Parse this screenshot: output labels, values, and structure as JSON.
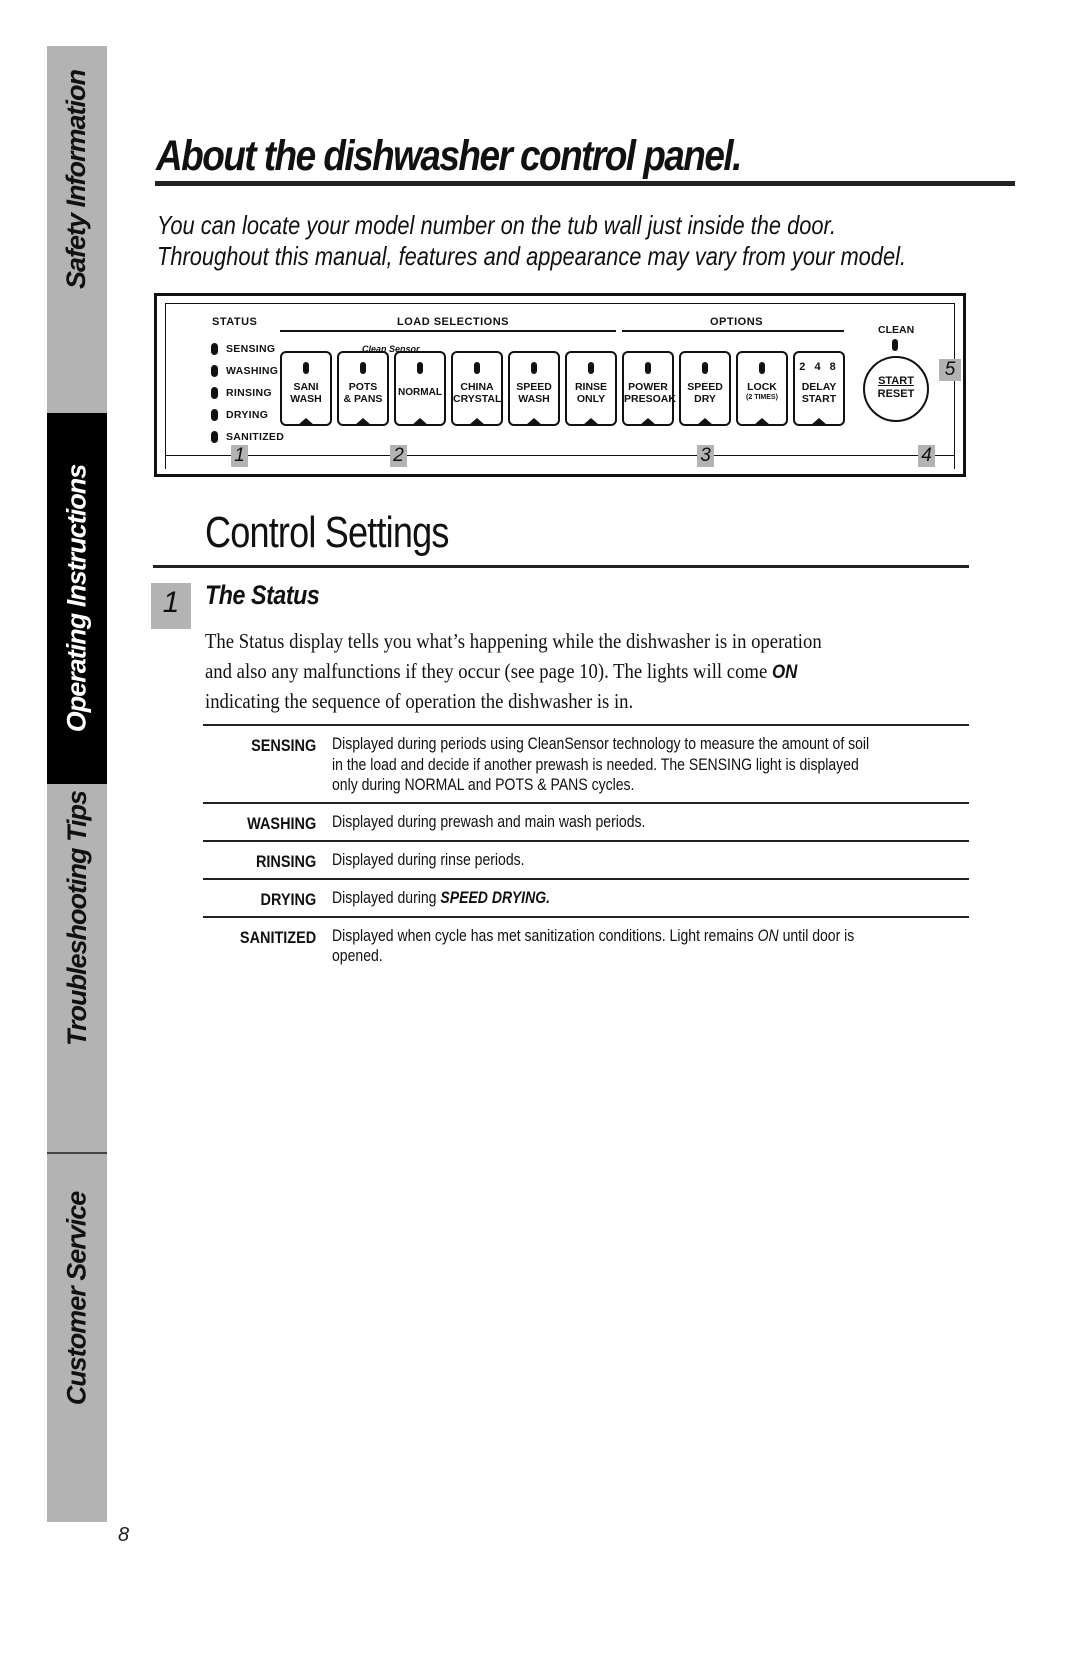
{
  "sidebar": {
    "tabs": [
      {
        "label": "Safety Information",
        "active": false
      },
      {
        "label": "Operating Instructions",
        "active": true
      },
      {
        "label": "Troubleshooting Tips",
        "active": false
      },
      {
        "label": "Customer Service",
        "active": false
      }
    ]
  },
  "page_number": "8",
  "header": {
    "title": "About the dishwasher control panel.",
    "intro_line1": "You can locate your model number on the tub wall just inside the door.",
    "intro_line2": "Throughout this manual, features and appearance may vary from your model."
  },
  "panel": {
    "status_title": "STATUS",
    "status_lights": [
      "SENSING",
      "WASHING",
      "RINSING",
      "DRYING",
      "SANITIZED"
    ],
    "load_selections_title": "LOAD SELECTIONS",
    "options_title": "OPTIONS",
    "clean_sensor_label": "Clean Sensor",
    "load_buttons": [
      {
        "line1": "SANI",
        "line2": "WASH"
      },
      {
        "line1": "POTS",
        "line2": "& PANS"
      },
      {
        "line1": "NORMAL",
        "line2": ""
      },
      {
        "line1": "CHINA",
        "line2": "CRYSTAL"
      },
      {
        "line1": "SPEED",
        "line2": "WASH"
      },
      {
        "line1": "RINSE",
        "line2": "ONLY"
      }
    ],
    "option_buttons": [
      {
        "line1": "POWER",
        "line2": "PRESOAK"
      },
      {
        "line1": "SPEED",
        "line2": "DRY"
      },
      {
        "line1": "LOCK",
        "line2": "(2 TIMES)"
      },
      {
        "line1": "DELAY",
        "line2": "START",
        "digits": "2 4 8"
      }
    ],
    "clean_label": "CLEAN",
    "start_button": {
      "line1": "START",
      "line2": "RESET"
    },
    "callouts": [
      "1",
      "2",
      "3",
      "4",
      "5"
    ]
  },
  "control_settings": {
    "heading": "Control Settings",
    "section_number": "1",
    "section_title": "The Status",
    "body_line1": "The Status display tells you what’s happening while the dishwasher is in operation",
    "body_line2_pre": "and also any malfunctions if they occur (see page 10). The lights will come ",
    "body_line2_bold": "ON",
    "body_line3": "indicating the sequence of operation the dishwasher is in.",
    "definitions": [
      {
        "term": "SENSING",
        "lines": [
          "Displayed during periods using CleanSensor technology to measure the amount of soil",
          "in the load and decide if another prewash is needed. The SENSING light is displayed",
          "only during NORMAL and POTS & PANS cycles."
        ]
      },
      {
        "term": "WASHING",
        "lines": [
          "Displayed during prewash and main wash periods."
        ]
      },
      {
        "term": "RINSING",
        "lines": [
          "Displayed during rinse periods."
        ]
      },
      {
        "term": "DRYING",
        "pre": "Displayed during ",
        "bold": "SPEED DRYING."
      },
      {
        "term": "SANITIZED",
        "pre": "Displayed when cycle has met sanitization conditions. Light remains ",
        "italic": "ON",
        "post": " until door is",
        "line2": "opened."
      }
    ]
  }
}
